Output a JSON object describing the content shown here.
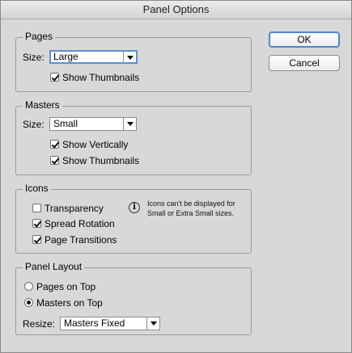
{
  "window": {
    "title": "Panel Options"
  },
  "buttons": {
    "ok": "OK",
    "cancel": "Cancel"
  },
  "pages": {
    "legend": "Pages",
    "size_label": "Size:",
    "size_value": "Large",
    "show_thumbnails": {
      "label": "Show Thumbnails",
      "checked": true
    }
  },
  "masters": {
    "legend": "Masters",
    "size_label": "Size:",
    "size_value": "Small",
    "show_vertically": {
      "label": "Show Vertically",
      "checked": true
    },
    "show_thumbnails": {
      "label": "Show Thumbnails",
      "checked": true
    }
  },
  "icons": {
    "legend": "Icons",
    "transparency": {
      "label": "Transparency",
      "checked": false
    },
    "spread_rotation": {
      "label": "Spread Rotation",
      "checked": true
    },
    "page_transitions": {
      "label": "Page Transitions",
      "checked": true
    },
    "info_icon": "info-icon",
    "note_line1": "Icons can't be displayed for",
    "note_line2": "Small or Extra Small sizes."
  },
  "panel_layout": {
    "legend": "Panel Layout",
    "pages_on_top": {
      "label": "Pages on Top",
      "selected": false
    },
    "masters_on_top": {
      "label": "Masters on Top",
      "selected": true
    },
    "resize_label": "Resize:",
    "resize_value": "Masters Fixed"
  }
}
